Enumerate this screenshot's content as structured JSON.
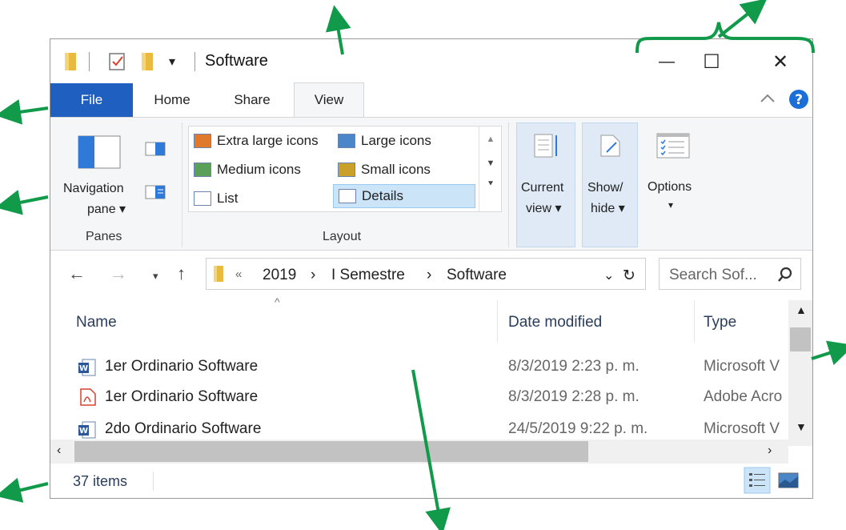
{
  "window": {
    "title": "Software",
    "quick_access_dropdown": "▾",
    "controls": {
      "minimize": "—",
      "maximize": "☐",
      "close": "✕"
    }
  },
  "tabs": [
    {
      "label": "File"
    },
    {
      "label": "Home"
    },
    {
      "label": "Share"
    },
    {
      "label": "View"
    }
  ],
  "ribbon": {
    "panes": {
      "navigation_pane_line1": "Navigation",
      "navigation_pane_line2": "pane ▾",
      "group_label": "Panes"
    },
    "layout": {
      "items": [
        {
          "label": "Extra large icons"
        },
        {
          "label": "Large icons"
        },
        {
          "label": "Medium icons"
        },
        {
          "label": "Small icons"
        },
        {
          "label": "List"
        },
        {
          "label": "Details",
          "selected": true
        }
      ],
      "group_label": "Layout"
    },
    "current_view": {
      "line1": "Current",
      "line2": "view ▾"
    },
    "show_hide": {
      "line1": "Show/",
      "line2": "hide ▾"
    },
    "options": {
      "line1": "Options",
      "line2": "▾"
    }
  },
  "address_bar": {
    "overflow": "«",
    "crumbs": [
      "2019",
      "I Semestre",
      "Software"
    ],
    "separator": "›",
    "search_placeholder": "Search Sof..."
  },
  "file_list": {
    "columns": [
      "Name",
      "Date modified",
      "Type"
    ],
    "rows": [
      {
        "name": "1er Ordinario Software",
        "date": "8/3/2019 2:23 p. m.",
        "type": "Microsoft V",
        "icon": "word-doc-icon"
      },
      {
        "name": "1er Ordinario Software",
        "date": "8/3/2019 2:28 p. m.",
        "type": "Adobe Acro",
        "icon": "pdf-icon"
      },
      {
        "name": "2do Ordinario Software",
        "date": "24/5/2019 9:22 p. m.",
        "type": "Microsoft V",
        "icon": "word-doc-icon"
      }
    ]
  },
  "status_bar": {
    "item_count": "37 items"
  },
  "colors": {
    "accent": "#1f5fbf",
    "arrow": "#109a4a",
    "selection": "#cce4f7"
  }
}
